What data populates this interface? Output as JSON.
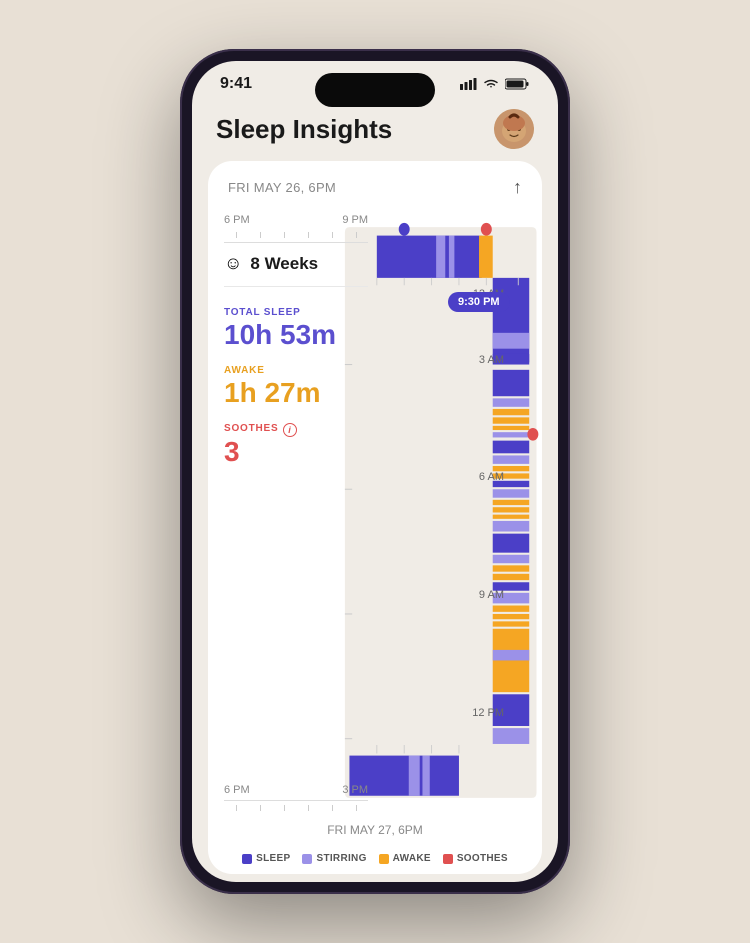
{
  "status_bar": {
    "time": "9:41",
    "signal_icon": "signal",
    "wifi_icon": "wifi",
    "battery_icon": "battery"
  },
  "header": {
    "title": "Sleep Insights",
    "avatar_emoji": "👶"
  },
  "card": {
    "top_date": "FRI MAY 26, 6PM",
    "bottom_date": "FRI MAY 27, 6PM",
    "share_icon": "↑",
    "time_labels_top": [
      "6 PM",
      "9 PM",
      "12 AM"
    ],
    "time_labels_right": [
      "3 AM",
      "6 AM",
      "9 AM",
      "12 PM"
    ],
    "time_labels_bottom": [
      "3 PM",
      "6 PM"
    ],
    "time_pill": "9:30 PM",
    "age": "8 Weeks",
    "stats": {
      "total_sleep_label": "TOTAL SLEEP",
      "total_sleep_value": "10h 53m",
      "awake_label": "AWAKE",
      "awake_value": "1h 27m",
      "soothes_label": "SOOTHES",
      "soothes_info": "i",
      "soothes_value": "3"
    },
    "legend": [
      {
        "color": "#4b3fc7",
        "label": "SLEEP"
      },
      {
        "color": "#9b91e8",
        "label": "STIRRING"
      },
      {
        "color": "#f5a623",
        "label": "AWAKE"
      },
      {
        "color": "#e05050",
        "label": "SOOTHES"
      }
    ]
  },
  "colors": {
    "background": "#e8e0d5",
    "card_bg": "#ffffff",
    "sleep": "#4b3fc7",
    "stirring": "#9b91e8",
    "awake": "#f5a623",
    "soothes": "#e05050",
    "track_bg": "#f0ece6"
  }
}
